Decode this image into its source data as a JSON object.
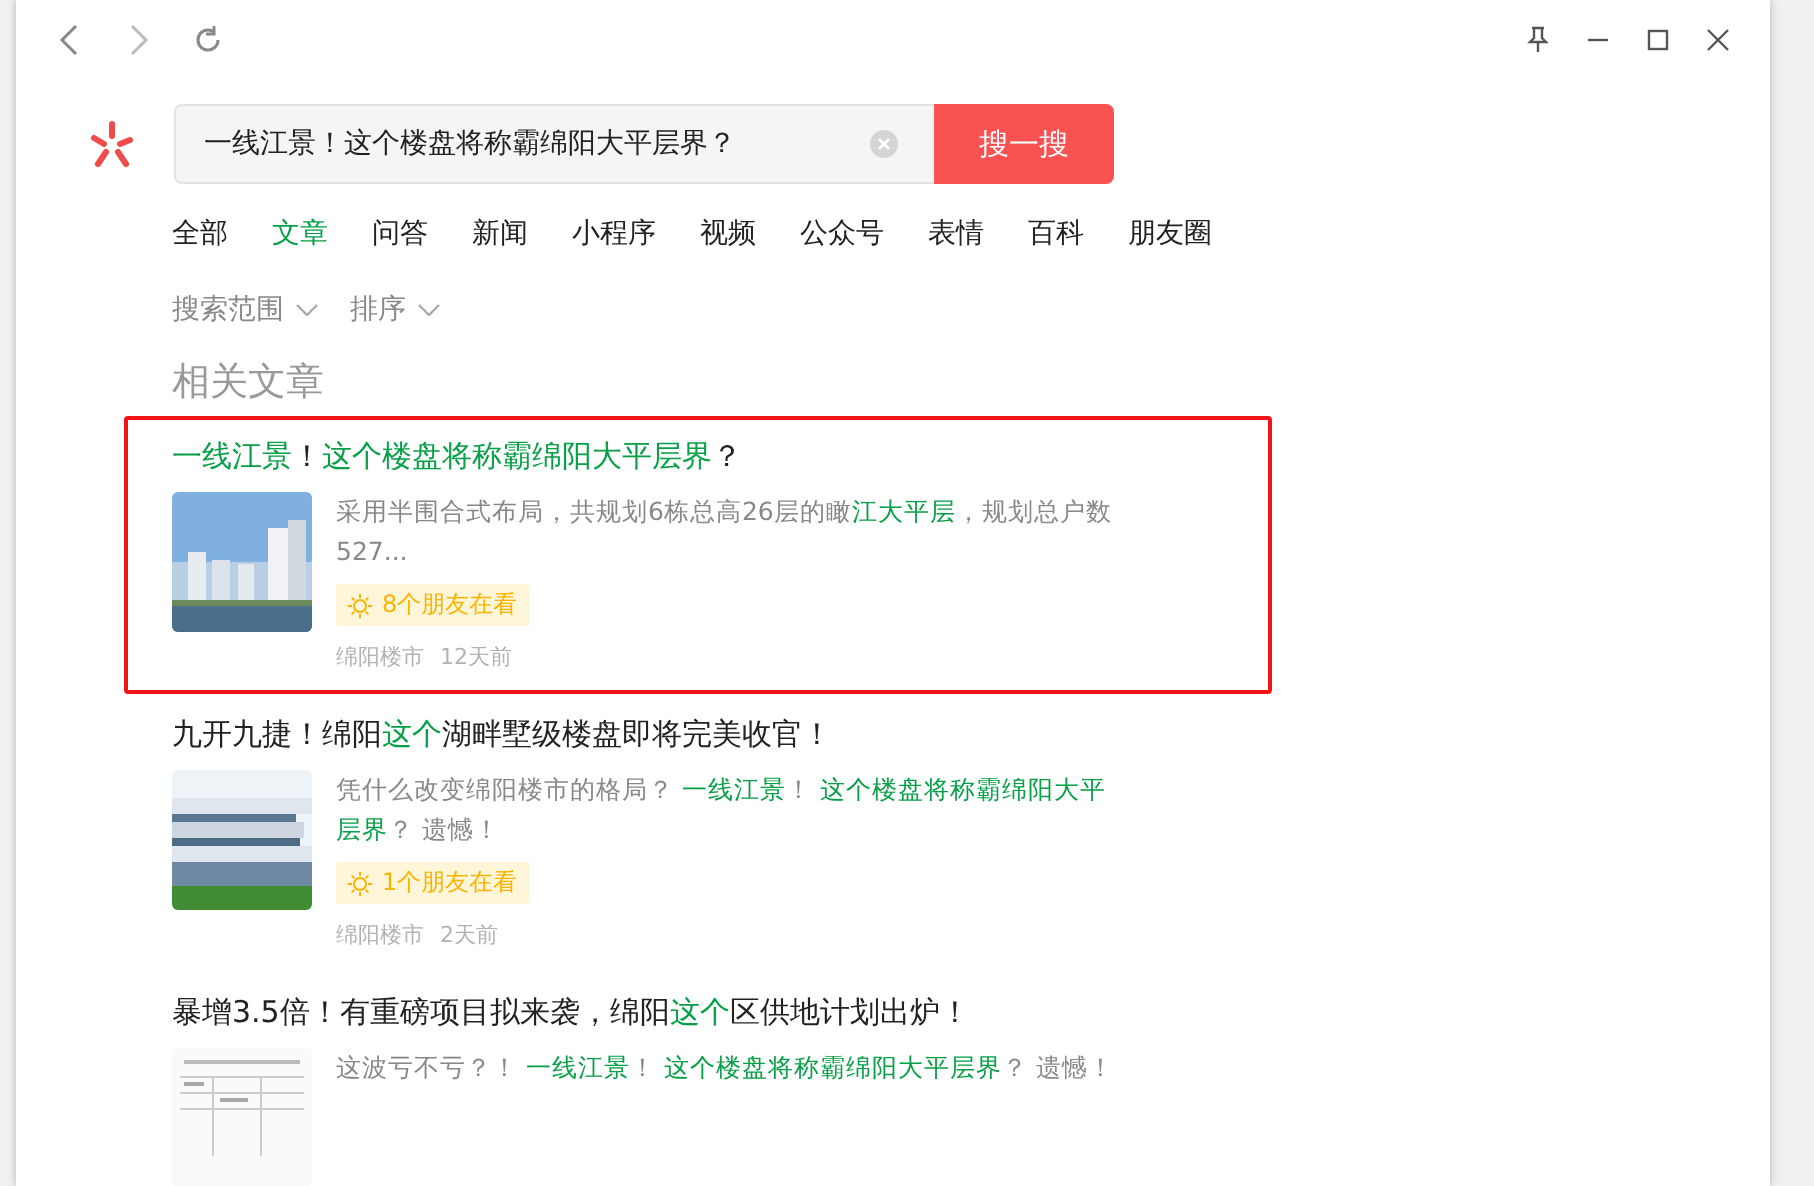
{
  "search": {
    "value": "一线江景！这个楼盘将称霸绵阳大平层界？",
    "button": "搜一搜"
  },
  "tabs": [
    {
      "label": "全部",
      "selected": false
    },
    {
      "label": "文章",
      "selected": true
    },
    {
      "label": "问答",
      "selected": false
    },
    {
      "label": "新闻",
      "selected": false
    },
    {
      "label": "小程序",
      "selected": false
    },
    {
      "label": "视频",
      "selected": false
    },
    {
      "label": "公众号",
      "selected": false
    },
    {
      "label": "表情",
      "selected": false
    },
    {
      "label": "百科",
      "selected": false
    },
    {
      "label": "朋友圈",
      "selected": false
    }
  ],
  "filters": [
    "搜索范围",
    "排序"
  ],
  "section_title": "相关文章",
  "results": [
    {
      "highlighted": true,
      "title": [
        {
          "text": "一线江景",
          "hl": true
        },
        {
          "text": "！",
          "hl": false
        },
        {
          "text": "这个楼盘将称霸绵阳大平层界",
          "hl": true
        },
        {
          "text": "？",
          "hl": false
        }
      ],
      "snippet": [
        {
          "text": "采用半围合式布局，共规划6栋总高26层的瞰",
          "hl": false
        },
        {
          "text": "江大平层",
          "hl": true
        },
        {
          "text": "，规划总户数527...",
          "hl": false
        }
      ],
      "friends": "8个朋友在看",
      "source": "绵阳楼市",
      "time": "12天前"
    },
    {
      "highlighted": false,
      "title": [
        {
          "text": "九开九捷！绵阳",
          "hl": false
        },
        {
          "text": "这个",
          "hl": true
        },
        {
          "text": "湖畔墅级楼盘即将完美收官！",
          "hl": false
        }
      ],
      "snippet": [
        {
          "text": "凭什么改变绵阳楼市的格局？ ",
          "hl": false
        },
        {
          "text": "一线江景",
          "hl": true
        },
        {
          "text": "！ ",
          "hl": false
        },
        {
          "text": "这个楼盘将称霸绵阳大平层界",
          "hl": true
        },
        {
          "text": "？ 遗憾！",
          "hl": false
        }
      ],
      "friends": "1个朋友在看",
      "source": "绵阳楼市",
      "time": "2天前"
    },
    {
      "highlighted": false,
      "title": [
        {
          "text": "暴增3.5倍！有重磅项目拟来袭，绵阳",
          "hl": false
        },
        {
          "text": "这个",
          "hl": true
        },
        {
          "text": "区供地计划出炉！",
          "hl": false
        }
      ],
      "snippet": [
        {
          "text": "这波亏不亏？！ ",
          "hl": false
        },
        {
          "text": "一线江景",
          "hl": true
        },
        {
          "text": "！ ",
          "hl": false
        },
        {
          "text": "这个楼盘将称霸绵阳大平层界",
          "hl": true
        },
        {
          "text": "？ 遗憾！",
          "hl": false
        }
      ]
    }
  ]
}
